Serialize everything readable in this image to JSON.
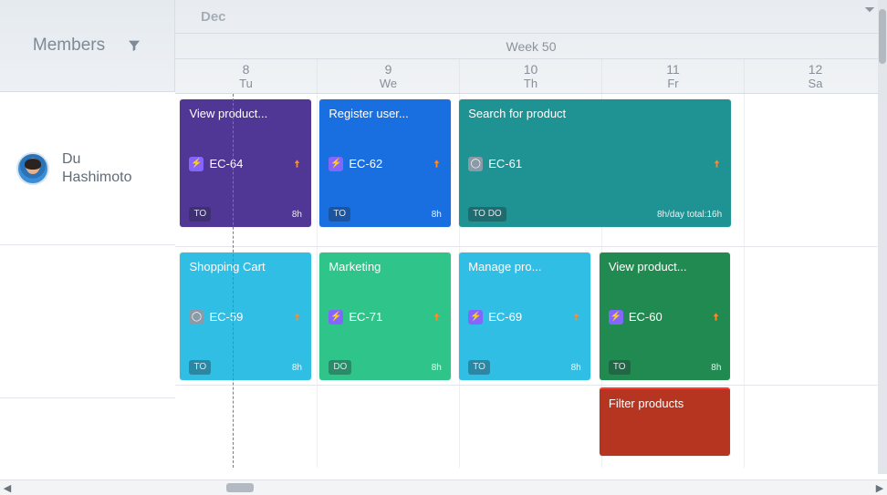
{
  "sidebar": {
    "title": "Members"
  },
  "member": {
    "first": "Du",
    "last": "Hashimoto"
  },
  "calendar": {
    "month": "Dec",
    "week_label": "Week 50",
    "days": [
      {
        "num": "8",
        "abbr": "Tu"
      },
      {
        "num": "9",
        "abbr": "We"
      },
      {
        "num": "10",
        "abbr": "Th"
      },
      {
        "num": "11",
        "abbr": "Fr"
      },
      {
        "num": "12",
        "abbr": "Sa"
      }
    ]
  },
  "cards": {
    "r1c1": {
      "title": "View product...",
      "key": "EC-64",
      "status": "TO",
      "hours": "8h"
    },
    "r1c2": {
      "title": "Register user...",
      "key": "EC-62",
      "status": "TO",
      "hours": "8h"
    },
    "r1c3": {
      "title": "Search for product",
      "key": "EC-61",
      "status": "TO DO",
      "hours": "8h/day total:16h"
    },
    "r2c1": {
      "title": "Shopping Cart",
      "key": "EC-59",
      "status": "TO",
      "hours": "8h"
    },
    "r2c2": {
      "title": "Marketing",
      "key": "EC-71",
      "status": "DO",
      "hours": "8h"
    },
    "r2c3": {
      "title": "Manage pro...",
      "key": "EC-69",
      "status": "TO",
      "hours": "8h"
    },
    "r2c4": {
      "title": "View product...",
      "key": "EC-60",
      "status": "TO",
      "hours": "8h"
    },
    "r3c4": {
      "title": "Filter products"
    }
  },
  "icons": {
    "epic": "⚡",
    "story": "◯"
  }
}
